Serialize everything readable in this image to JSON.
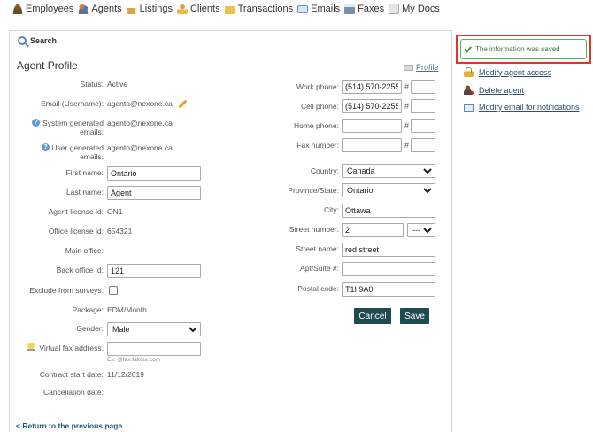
{
  "nav": {
    "items": [
      {
        "label": "Employees",
        "icon": "employees-icon"
      },
      {
        "label": "Agents",
        "icon": "agents-icon"
      },
      {
        "label": "Listings",
        "icon": "listings-icon"
      },
      {
        "label": "Clients",
        "icon": "clients-icon"
      },
      {
        "label": "Transactions",
        "icon": "transactions-icon"
      },
      {
        "label": "Emails",
        "icon": "emails-icon"
      },
      {
        "label": "Faxes",
        "icon": "faxes-icon"
      },
      {
        "label": "My Docs",
        "icon": "my-docs-icon"
      }
    ]
  },
  "search": {
    "label": "Search"
  },
  "page": {
    "title": "Agent Profile",
    "profile_link": "Profile"
  },
  "left": {
    "status_label": "Status:",
    "status_value": "Active",
    "email_label": "Email (Username):",
    "email_value": "agento@nexone.ca",
    "sys_emails_label": "System generated emails:",
    "sys_emails_value": "agento@nexone.ca",
    "user_emails_label": "User generated emails:",
    "user_emails_value": "agento@nexone.ca",
    "first_name_label": "First name:",
    "first_name_value": "Ontario",
    "last_name_label": "Last name:",
    "last_name_value": "Agent",
    "agent_license_label": "Agent license id:",
    "agent_license_value": "ON1",
    "office_license_label": "Office license id:",
    "office_license_value": "654321",
    "main_office_label": "Main office:",
    "main_office_value": "",
    "back_office_label": "Back office Id:",
    "back_office_value": "121",
    "exclude_label": "Exclude from surveys:",
    "package_label": "Package:",
    "package_value": "EDM/Month",
    "gender_label": "Gender:",
    "gender_value": "Male",
    "virtual_fax_label": "Virtual fax address:",
    "virtual_fax_value": "",
    "virtual_fax_hint": "Ex: @fax.faltour.com",
    "contract_start_label": "Contract start date:",
    "contract_start_value": "11/12/2019",
    "cancellation_label": "Cancellation date:",
    "cancellation_value": ""
  },
  "right": {
    "work_phone_label": "Work phone:",
    "work_phone_value": "(514) 570-2255",
    "work_ext": "",
    "cell_phone_label": "Cell phone:",
    "cell_phone_value": "(514) 570-2255",
    "cell_ext": "",
    "home_phone_label": "Home phone:",
    "home_phone_value": "",
    "home_ext": "",
    "fax_number_label": "Fax number:",
    "fax_number_value": "",
    "fax_ext": "",
    "hash": "#",
    "country_label": "Country:",
    "country_value": "Canada",
    "province_label": "Province/State:",
    "province_value": "Ontario",
    "city_label": "City:",
    "city_value": "Ottawa",
    "street_number_label": "Street number:",
    "street_number_value": "2",
    "street_suffix_value": "---",
    "street_name_label": "Street name:",
    "street_name_value": "red street",
    "apt_label": "Apt/Suite #:",
    "apt_value": "",
    "postal_label": "Postal code:",
    "postal_value": "T1I 9A0",
    "cancel_label": "Cancel",
    "save_label": "Save"
  },
  "back_link": "< Return to the previous page",
  "sidebar": {
    "notice": "The information was saved",
    "items": [
      {
        "label": "Modify agent access"
      },
      {
        "label": "Delete agent"
      },
      {
        "label": "Modify email for notifications"
      }
    ]
  }
}
